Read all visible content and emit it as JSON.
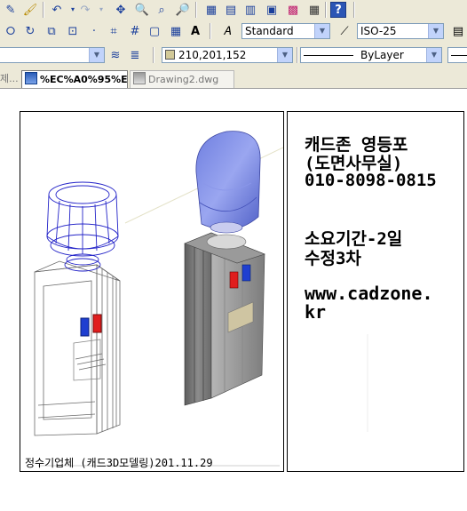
{
  "toolbar": {
    "text_style": "Standard",
    "dim_style": "ISO-25",
    "color_value": "210,201,152",
    "linetype": "ByLayer",
    "colors": {
      "swatch": "#d2c998",
      "toolbar_bg": "#ece9d8"
    }
  },
  "tabs": [
    {
      "label": "제..."
    },
    {
      "label": "%EC%A0%95%EC..."
    },
    {
      "label": "Drawing2.dwg"
    }
  ],
  "drawing": {
    "caption": "정수기업체 (캐드3D모델링)201.11.29",
    "notes": {
      "line1": "캐드존 영등포",
      "line2": "(도면사무실)",
      "phone": "010-8098-0815",
      "line4": "소요기간-2일",
      "line5": "수정3차",
      "site1": "www.cadzone.",
      "site2": "kr"
    }
  }
}
